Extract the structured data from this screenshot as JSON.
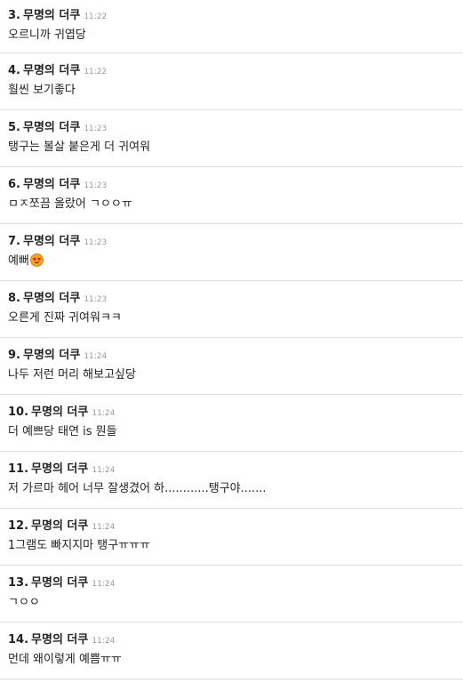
{
  "comments": [
    {
      "num": "3.",
      "author": "무명의 더쿠",
      "time": "11:22",
      "text": "오르니까 귀엽당"
    },
    {
      "num": "4.",
      "author": "무명의 더쿠",
      "time": "11:22",
      "text": "훨씬 보기좋다"
    },
    {
      "num": "5.",
      "author": "무명의 더쿠",
      "time": "11:23",
      "text": "탱구는 볼살 붙은게 더 귀여워"
    },
    {
      "num": "6.",
      "author": "무명의 더쿠",
      "time": "11:23",
      "text": "ㅁㅈ쪼끔 올랐어 ㄱㅇㅇㅠ"
    },
    {
      "num": "7.",
      "author": "무명의 더쿠",
      "time": "11:23",
      "text": "예뻐",
      "emoji": "heart-eyes-emoji-icon"
    },
    {
      "num": "8.",
      "author": "무명의 더쿠",
      "time": "11:23",
      "text": "오른게 진짜 귀여워ㅋㅋ"
    },
    {
      "num": "9.",
      "author": "무명의 더쿠",
      "time": "11:24",
      "text": "나두 저런 머리 해보고싶당"
    },
    {
      "num": "10.",
      "author": "무명의 더쿠",
      "time": "11:24",
      "text": "더 예쁘당 태연 is 뭔들"
    },
    {
      "num": "11.",
      "author": "무명의 더쿠",
      "time": "11:24",
      "text": "저 가르마 헤어 너무 잘생겼어 하............탱구야......."
    },
    {
      "num": "12.",
      "author": "무명의 더쿠",
      "time": "11:24",
      "text": "1그램도 빠지지마 탱구ㅠㅠㅠ"
    },
    {
      "num": "13.",
      "author": "무명의 더쿠",
      "time": "11:24",
      "text": "ㄱㅇㅇ"
    },
    {
      "num": "14.",
      "author": "무명의 더쿠",
      "time": "11:24",
      "text": "먼데 왜이렇게 예쁨ㅠㅠ"
    }
  ]
}
